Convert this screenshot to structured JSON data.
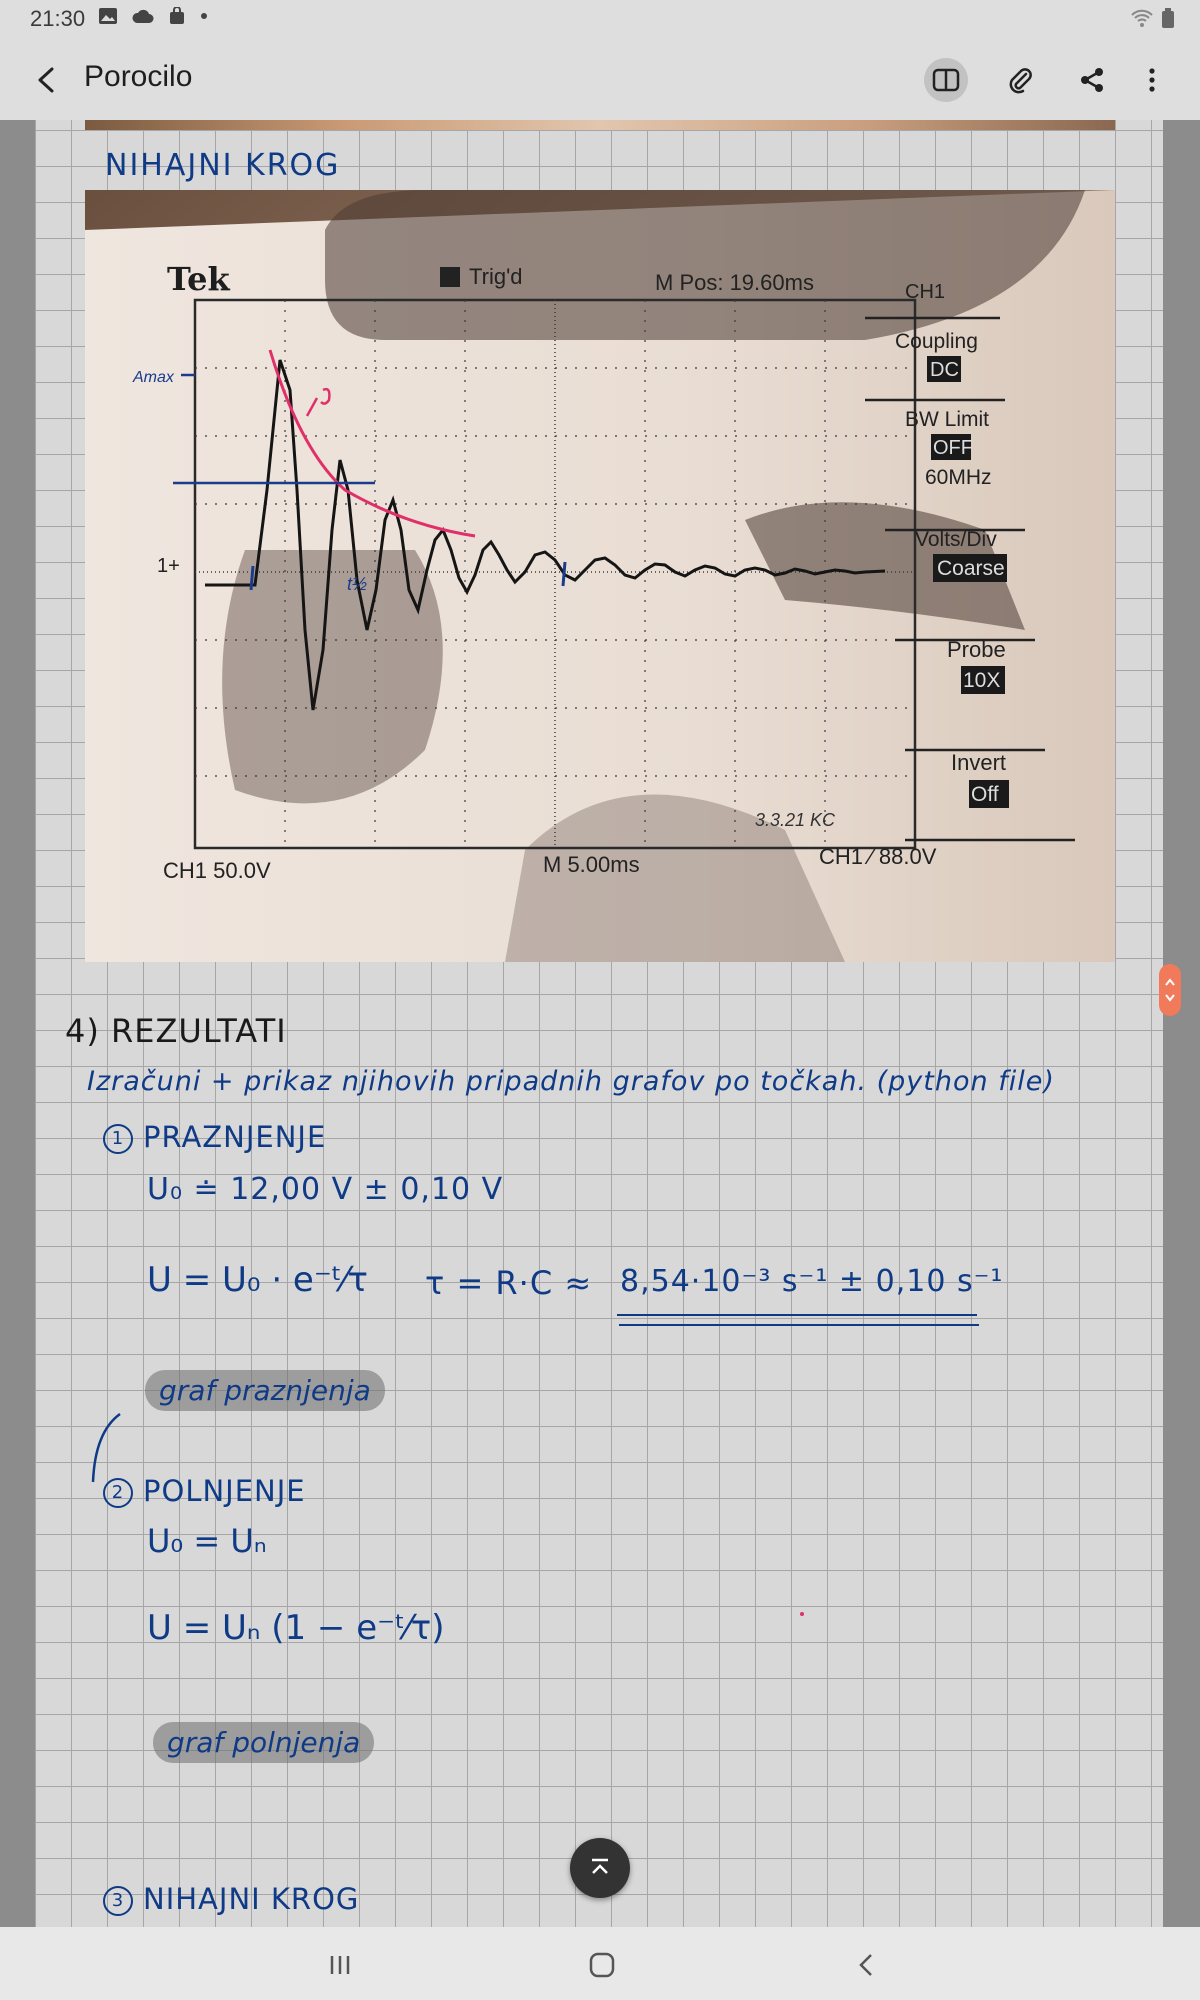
{
  "status_bar": {
    "time": "21:30",
    "left_icons": [
      "gallery-icon",
      "cloud-icon",
      "bag-icon",
      "dot-icon"
    ],
    "right_icons": [
      "wifi-icon",
      "battery-icon"
    ]
  },
  "app_bar": {
    "title": "Porocilo",
    "actions": [
      "book-view-icon",
      "attach-icon",
      "share-icon",
      "more-icon"
    ]
  },
  "note": {
    "heading_top": "NIHAJNI KROG",
    "photo": {
      "brand": "Tek",
      "trig": "Trig'd",
      "mpos": "M Pos: 19.60ms",
      "ch1": "CH1",
      "menu": [
        {
          "label": "Coupling",
          "value": "DC"
        },
        {
          "label": "BW Limit",
          "value": "OFF",
          "extra": "60MHz"
        },
        {
          "label": "Volts/Div",
          "value": "Coarse"
        },
        {
          "label": "Probe",
          "value": "10X"
        },
        {
          "label": "Invert",
          "value": "Off"
        }
      ],
      "bottom_left": "CH1  50.0V",
      "bottom_mid": "M 5.00ms",
      "bottom_right": "CH1 ∕ 88.0V",
      "marker_1": "1+",
      "ann_amax": "Amax",
      "ann_thalf": "t½",
      "signature": "3.3.21 KC"
    },
    "results_heading": "4) REZULTATI",
    "results_line": "Izračuni + prikaz njihovih pripadnih grafov po točkah. (python file)",
    "section1": {
      "num": "1",
      "title": "PRAZNJENJE"
    },
    "u0_line": "U₀ ≐ 12,00 V  ± 0,10 V",
    "eq_discharge": "U = U₀ · e⁻ᵗ⁄τ",
    "tau_def": "τ = R·C ≈",
    "tau_value": "8,54·10⁻³ s⁻¹  ± 0,10 s⁻¹",
    "graf1": "graf praznjenja",
    "section2": {
      "num": "2",
      "title": "POLNJENJE"
    },
    "u0_eq_un": "U₀ = Uₙ",
    "eq_charge": "U = Uₙ (1 − e⁻ᵗ⁄τ)",
    "graf2": "graf polnjenja",
    "section3": {
      "num": "3",
      "title": "NIHAJNI KROG"
    }
  },
  "colors": {
    "ink": "#0f3a86",
    "pink": "#e0306a",
    "grid": "#a6a6a6",
    "page": "#d8d8d8"
  }
}
